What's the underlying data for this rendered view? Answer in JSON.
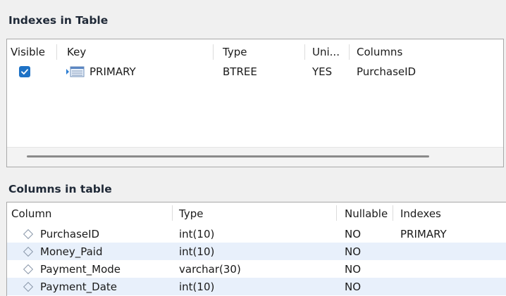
{
  "indexes": {
    "title": "Indexes in Table",
    "headers": {
      "visible": "Visible",
      "key": "Key",
      "type": "Type",
      "unique": "Uni...",
      "columns": "Columns"
    },
    "rows": [
      {
        "visible": true,
        "key": "PRIMARY",
        "key_icon": "index-key-icon",
        "type": "BTREE",
        "unique": "YES",
        "columns": "PurchaseID"
      }
    ]
  },
  "columns": {
    "title": "Columns in table",
    "headers": {
      "column": "Column",
      "type": "Type",
      "nullable": "Nullable",
      "indexes": "Indexes"
    },
    "rows": [
      {
        "name": "PurchaseID",
        "type": "int(10)",
        "nullable": "NO",
        "indexes": "PRIMARY"
      },
      {
        "name": "Money_Paid",
        "type": "int(10)",
        "nullable": "NO",
        "indexes": ""
      },
      {
        "name": "Payment_Mode",
        "type": "varchar(30)",
        "nullable": "NO",
        "indexes": ""
      },
      {
        "name": "Payment_Date",
        "type": "int(10)",
        "nullable": "NO",
        "indexes": ""
      }
    ]
  },
  "colors": {
    "checkbox": "#1e72c6",
    "row_alt": "#e8f0fb"
  }
}
